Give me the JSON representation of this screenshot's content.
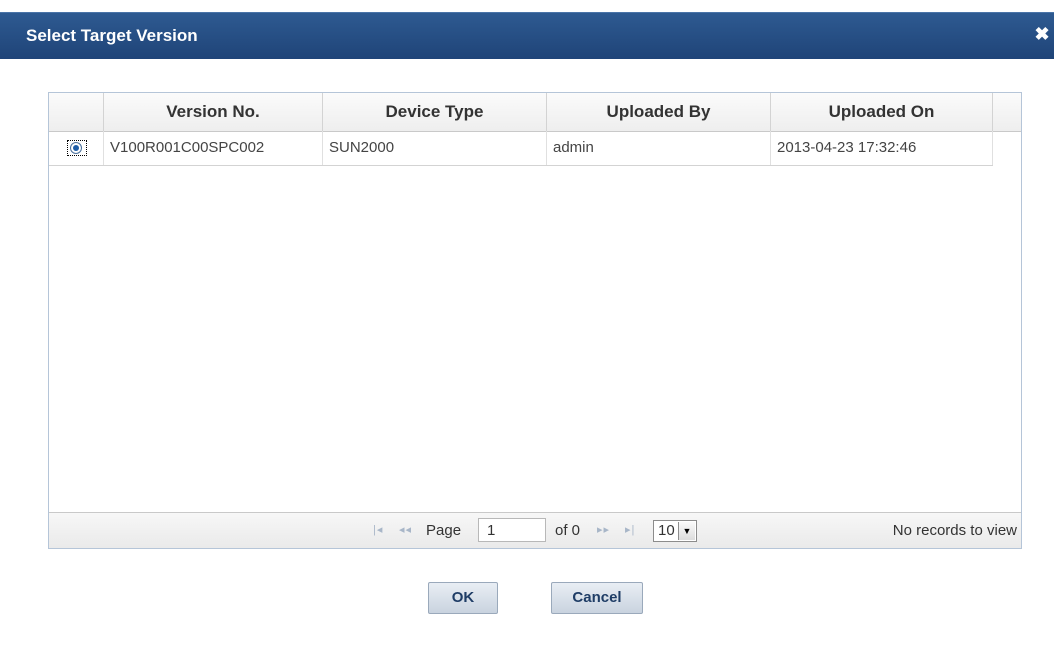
{
  "dialog": {
    "title": "Select Target Version",
    "close_glyph": "✖"
  },
  "table": {
    "columns": [
      "Version No.",
      "Device Type",
      "Uploaded By",
      "Uploaded On"
    ],
    "rows": [
      {
        "selected": true,
        "version": "V100R001C00SPC002",
        "device_type": "SUN2000",
        "uploaded_by": "admin",
        "uploaded_on": "2013-04-23 17:32:46"
      }
    ]
  },
  "pager": {
    "first_glyph": "|◂",
    "prev_glyph": "◂◂",
    "next_glyph": "▸▸",
    "last_glyph": "▸|",
    "page_label": "Page",
    "page_value": "1",
    "of_text": "of 0",
    "rows_per_page": "10",
    "dropdown_glyph": "▼",
    "records_text": "No records to view"
  },
  "buttons": {
    "ok": "OK",
    "cancel": "Cancel"
  },
  "colors": {
    "titlebar": "#1f4478",
    "radio_dot": "#1f5ea8",
    "button_text": "#1f3d66"
  }
}
